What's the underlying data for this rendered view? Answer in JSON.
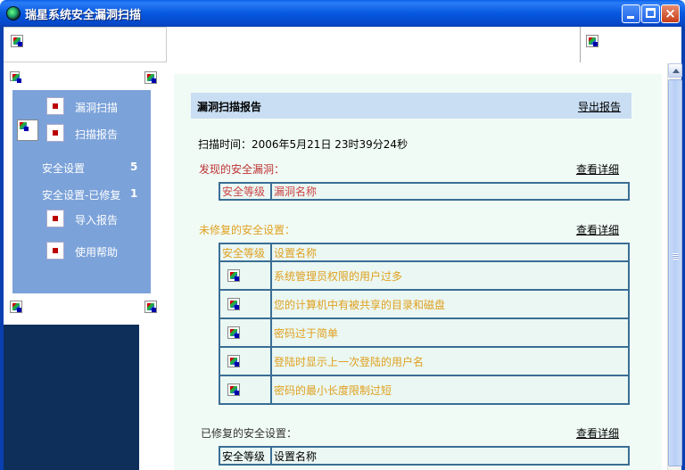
{
  "window": {
    "title": "瑞星系统安全漏洞扫描",
    "minimize_icon": "minimize-icon",
    "maximize_icon": "maximize-icon",
    "close_icon": "close-icon",
    "close_glyph": "×"
  },
  "nav": {
    "items": [
      {
        "label": "漏洞扫描",
        "icon": "scan-icon"
      },
      {
        "label": "扫描报告",
        "icon": "report-icon"
      },
      {
        "label": "安全设置",
        "count": "5"
      },
      {
        "label": "安全设置-已修复",
        "count": "1"
      },
      {
        "label": "导入报告",
        "icon": "import-icon"
      },
      {
        "label": "使用帮助",
        "icon": "help-icon"
      }
    ]
  },
  "report": {
    "title": "漏洞扫描报告",
    "export_link": "导出报告",
    "scan_time": "扫描时间：2006年5月21日 23时39分24秒",
    "found": {
      "title": "发现的安全漏洞：",
      "detail_link": "查看详细",
      "headers": [
        "安全等级",
        "漏洞名称"
      ]
    },
    "unfixed": {
      "title": "未修复的安全设置：",
      "detail_link": "查看详细",
      "headers": [
        "安全等级",
        "设置名称"
      ],
      "rows": [
        "系统管理员权限的用户过多",
        "您的计算机中有被共享的目录和磁盘",
        "密码过于简单",
        "登陆时显示上一次登陆的用户名",
        "密码的最小长度限制过短"
      ]
    },
    "fixed": {
      "title": "已修复的安全设置：",
      "detail_link": "查看详细",
      "headers": [
        "安全等级",
        "设置名称"
      ]
    }
  },
  "colors": {
    "titlebar": "#0758e0",
    "nav_bg": "#7ba2d9",
    "report_header_bg": "#c9def3",
    "content_bg": "#f1fbf6",
    "table_border": "#3a6e95",
    "found_text": "#cc4444",
    "unfixed_text": "#e0a020"
  }
}
